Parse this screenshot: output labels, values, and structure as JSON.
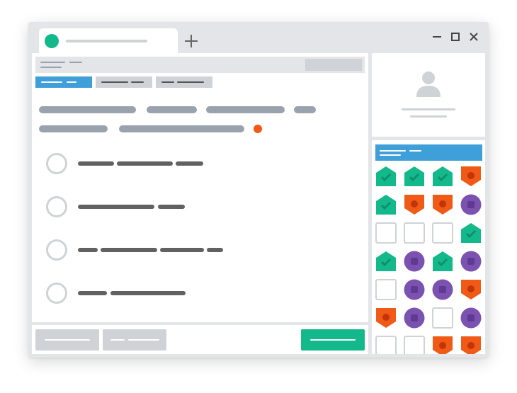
{
  "colors": {
    "window_chrome": "#e3e5e8",
    "panel": "#ffffff",
    "accent_blue": "#3f9fd9",
    "accent_green": "#13b98b",
    "orange": "#f05a16",
    "purple": "#7b52b0",
    "text_gray": "#9aa3ad",
    "text_dark": "#616161",
    "button_gray": "#cfd2d6",
    "radio_border": "#cfd2d6"
  },
  "browser": {
    "tab": {
      "favicon": "green-dot-icon",
      "title": ""
    },
    "new_tab_icon": "plus-icon",
    "window_controls": [
      "minimize-icon",
      "maximize-icon",
      "close-icon"
    ]
  },
  "main": {
    "toolbar_tabs": [
      {
        "label": "",
        "active": true
      },
      {
        "label": "",
        "active": false
      },
      {
        "label": "",
        "active": false
      }
    ],
    "options": [
      {
        "label": "",
        "selected": false
      },
      {
        "label": "",
        "selected": false
      },
      {
        "label": "",
        "selected": false
      },
      {
        "label": "",
        "selected": false
      }
    ],
    "status_dot": "orange-dot-icon"
  },
  "footer": {
    "buttons": [
      {
        "label": "",
        "kind": "secondary"
      },
      {
        "label": "",
        "kind": "secondary"
      },
      {
        "label": "",
        "kind": "primary"
      }
    ]
  },
  "sidebar": {
    "profile_icon": "user-avatar-icon",
    "header_label": "",
    "grid": [
      [
        "green-check",
        "green-check",
        "green-check",
        "orange-dot"
      ],
      [
        "green-check",
        "orange-dot",
        "orange-dot",
        "purple-square"
      ],
      [
        "empty",
        "empty",
        "empty",
        "green-check"
      ],
      [
        "green-check",
        "purple-square",
        "green-check",
        "purple-square"
      ],
      [
        "empty",
        "purple-square",
        "purple-square",
        "orange-dot"
      ],
      [
        "orange-dot",
        "purple-square",
        "empty",
        "purple-square"
      ],
      [
        "empty",
        "empty",
        "orange-dot",
        "orange-dot"
      ]
    ]
  }
}
